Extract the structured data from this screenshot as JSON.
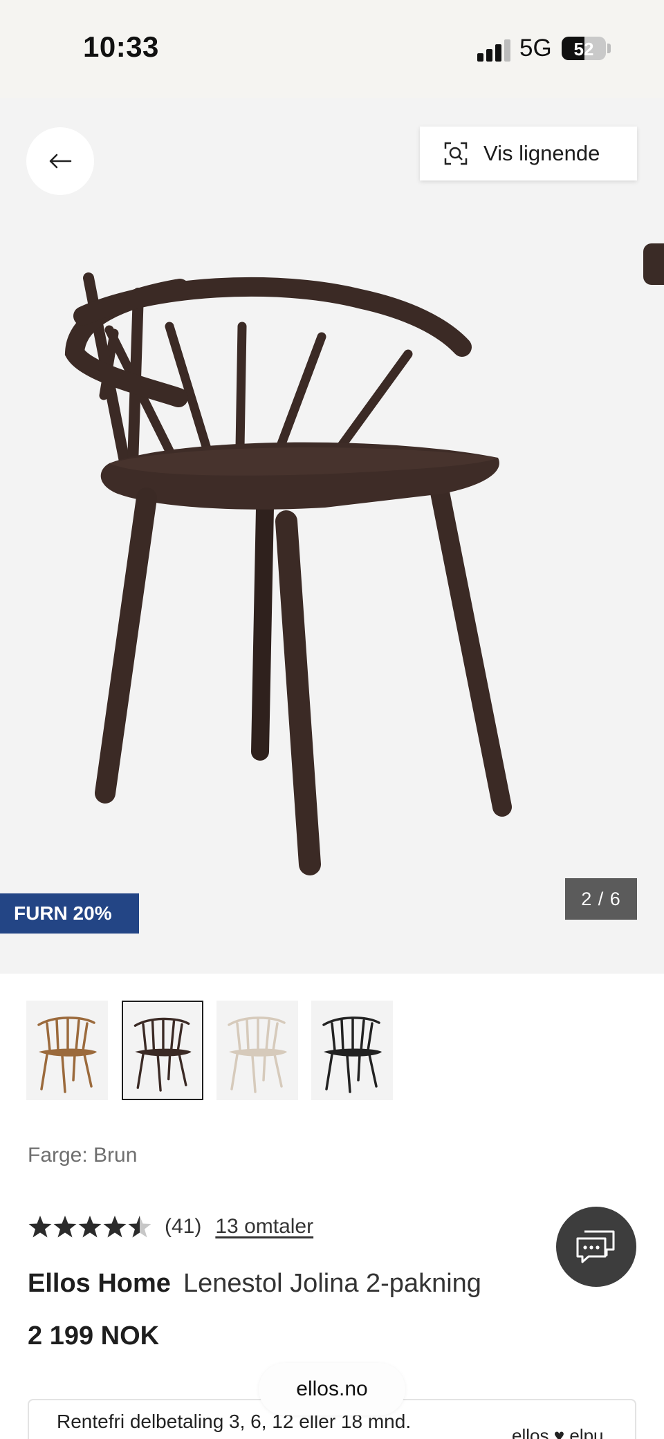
{
  "status_bar": {
    "time": "10:33",
    "network": "5G",
    "battery": "52"
  },
  "gallery": {
    "similar_label": "Vis lignende",
    "promo_badge": "FURN 20%",
    "counter": "2 / 6"
  },
  "swatches": [
    {
      "name": "brown-light"
    },
    {
      "name": "brown-dark",
      "selected": true
    },
    {
      "name": "white"
    },
    {
      "name": "black"
    }
  ],
  "color_label": "Farge: Brun",
  "rating": {
    "stars": 4.5,
    "count": "(41)",
    "reviews_link": "13 omtaler"
  },
  "product": {
    "brand": "Ellos Home",
    "name": "Lenestol Jolina 2-pakning",
    "price": "2 199 NOK"
  },
  "browser": {
    "url": "ellos.no"
  },
  "finance": {
    "text": "Rentefri delbetaling 3, 6, 12 eller 18 mnd.",
    "logo": "ellos ♥ elpu"
  },
  "colors": {
    "chair_dark": "#3b2a25",
    "chair_oak": "#9b6a3c",
    "chair_white": "#dcd1c4",
    "chair_black": "#222222",
    "promo_bg": "#234585",
    "chat_bg": "#3d3d3d"
  },
  "icons": [
    "back-arrow-icon",
    "visual-search-icon",
    "star-icon",
    "chat-icon"
  ]
}
